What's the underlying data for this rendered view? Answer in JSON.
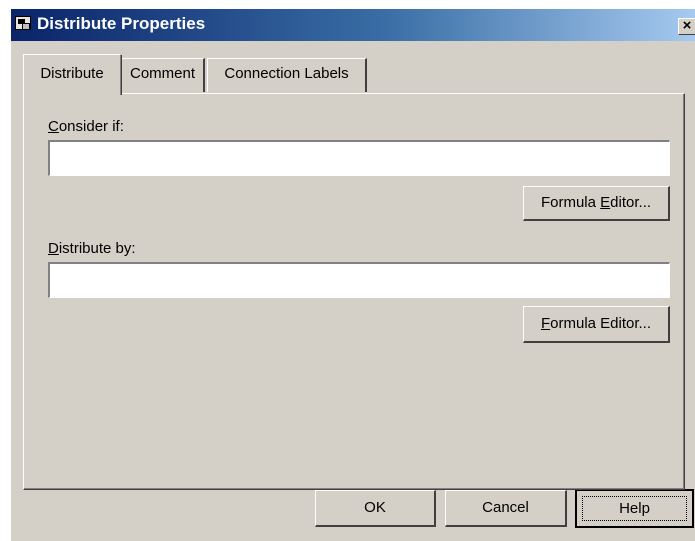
{
  "window": {
    "title": "Distribute Properties",
    "close_glyph": "×"
  },
  "tabs": [
    {
      "label": "Distribute",
      "active": true
    },
    {
      "label": "Comment",
      "active": false
    },
    {
      "label": "Connection Labels",
      "active": false
    }
  ],
  "consider": {
    "label_mnemonic": "C",
    "label_rest": "onsider if:",
    "value": "",
    "formula_button": {
      "before": "Formula ",
      "mnemonic": "E",
      "after": "ditor..."
    }
  },
  "distribute_by": {
    "label_mnemonic": "D",
    "label_rest": "istribute by:",
    "value": "",
    "formula_button": {
      "before": "",
      "mnemonic": "F",
      "after": "ormula Editor..."
    }
  },
  "footer": {
    "ok": "OK",
    "cancel": "Cancel",
    "help": "Help"
  },
  "colors": {
    "face": "#d4d0c8",
    "title_start": "#0a246a",
    "title_end": "#a6caf0"
  },
  "icons": {
    "app": "distribute-app-icon",
    "close": "close-icon"
  }
}
